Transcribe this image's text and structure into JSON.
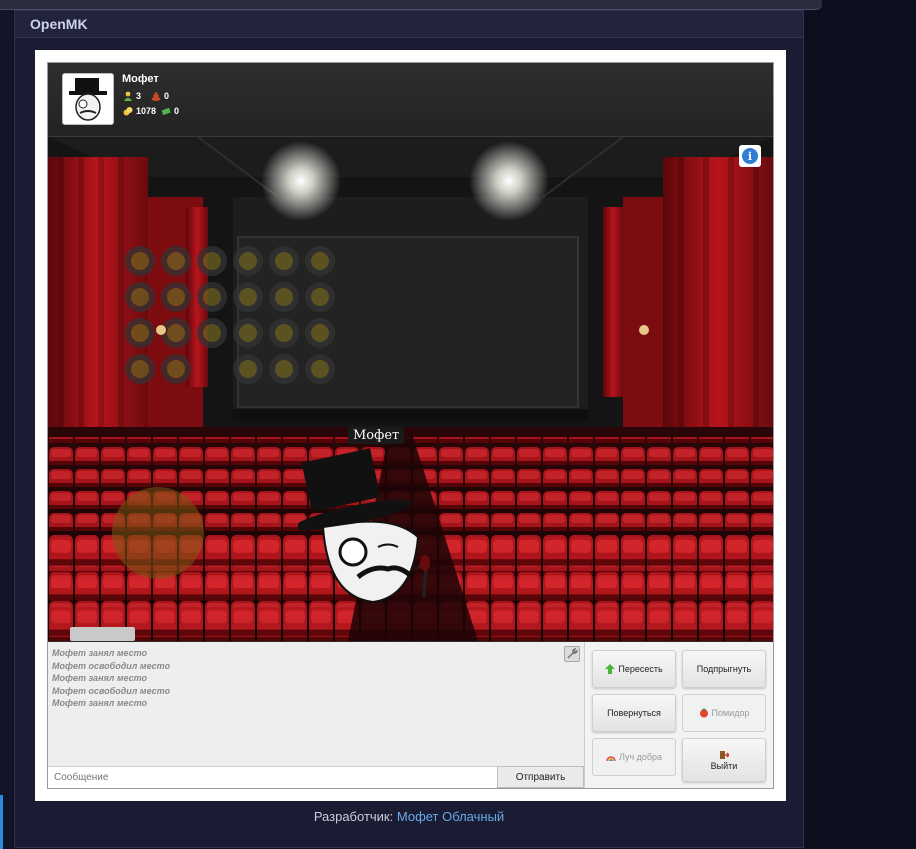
{
  "app": {
    "title": "OpenMK"
  },
  "profile": {
    "name": "Мофет",
    "stats": [
      {
        "icon": "user-icon",
        "value": "3"
      },
      {
        "icon": "poop-icon",
        "value": "0"
      },
      {
        "icon": "coins-icon",
        "value": "1078"
      },
      {
        "icon": "money-icon",
        "value": "0"
      }
    ]
  },
  "scene": {
    "player_name": "Мофет",
    "info_symbol": "i"
  },
  "chat": {
    "lines": [
      "Мофет занял место",
      "Мофет освободил место",
      "Мофет занял место",
      "Мофет освободил место",
      "Мофет занял место"
    ],
    "input_placeholder": "Сообщение",
    "send_label": "Отправить"
  },
  "actions": {
    "reseat": "Пересесть",
    "jump": "Подпрыгнуть",
    "turn": "Повернуться",
    "tomato": "Помидор",
    "ray": "Луч добра",
    "exit": "Выйти"
  },
  "footer": {
    "label": "Разработчик:",
    "developer": "Мофет Облачный"
  },
  "colors": {
    "curtain": "#a3141a",
    "seat": "#b3161c",
    "info": "#2f7fd6",
    "link": "#6aa9e8"
  }
}
